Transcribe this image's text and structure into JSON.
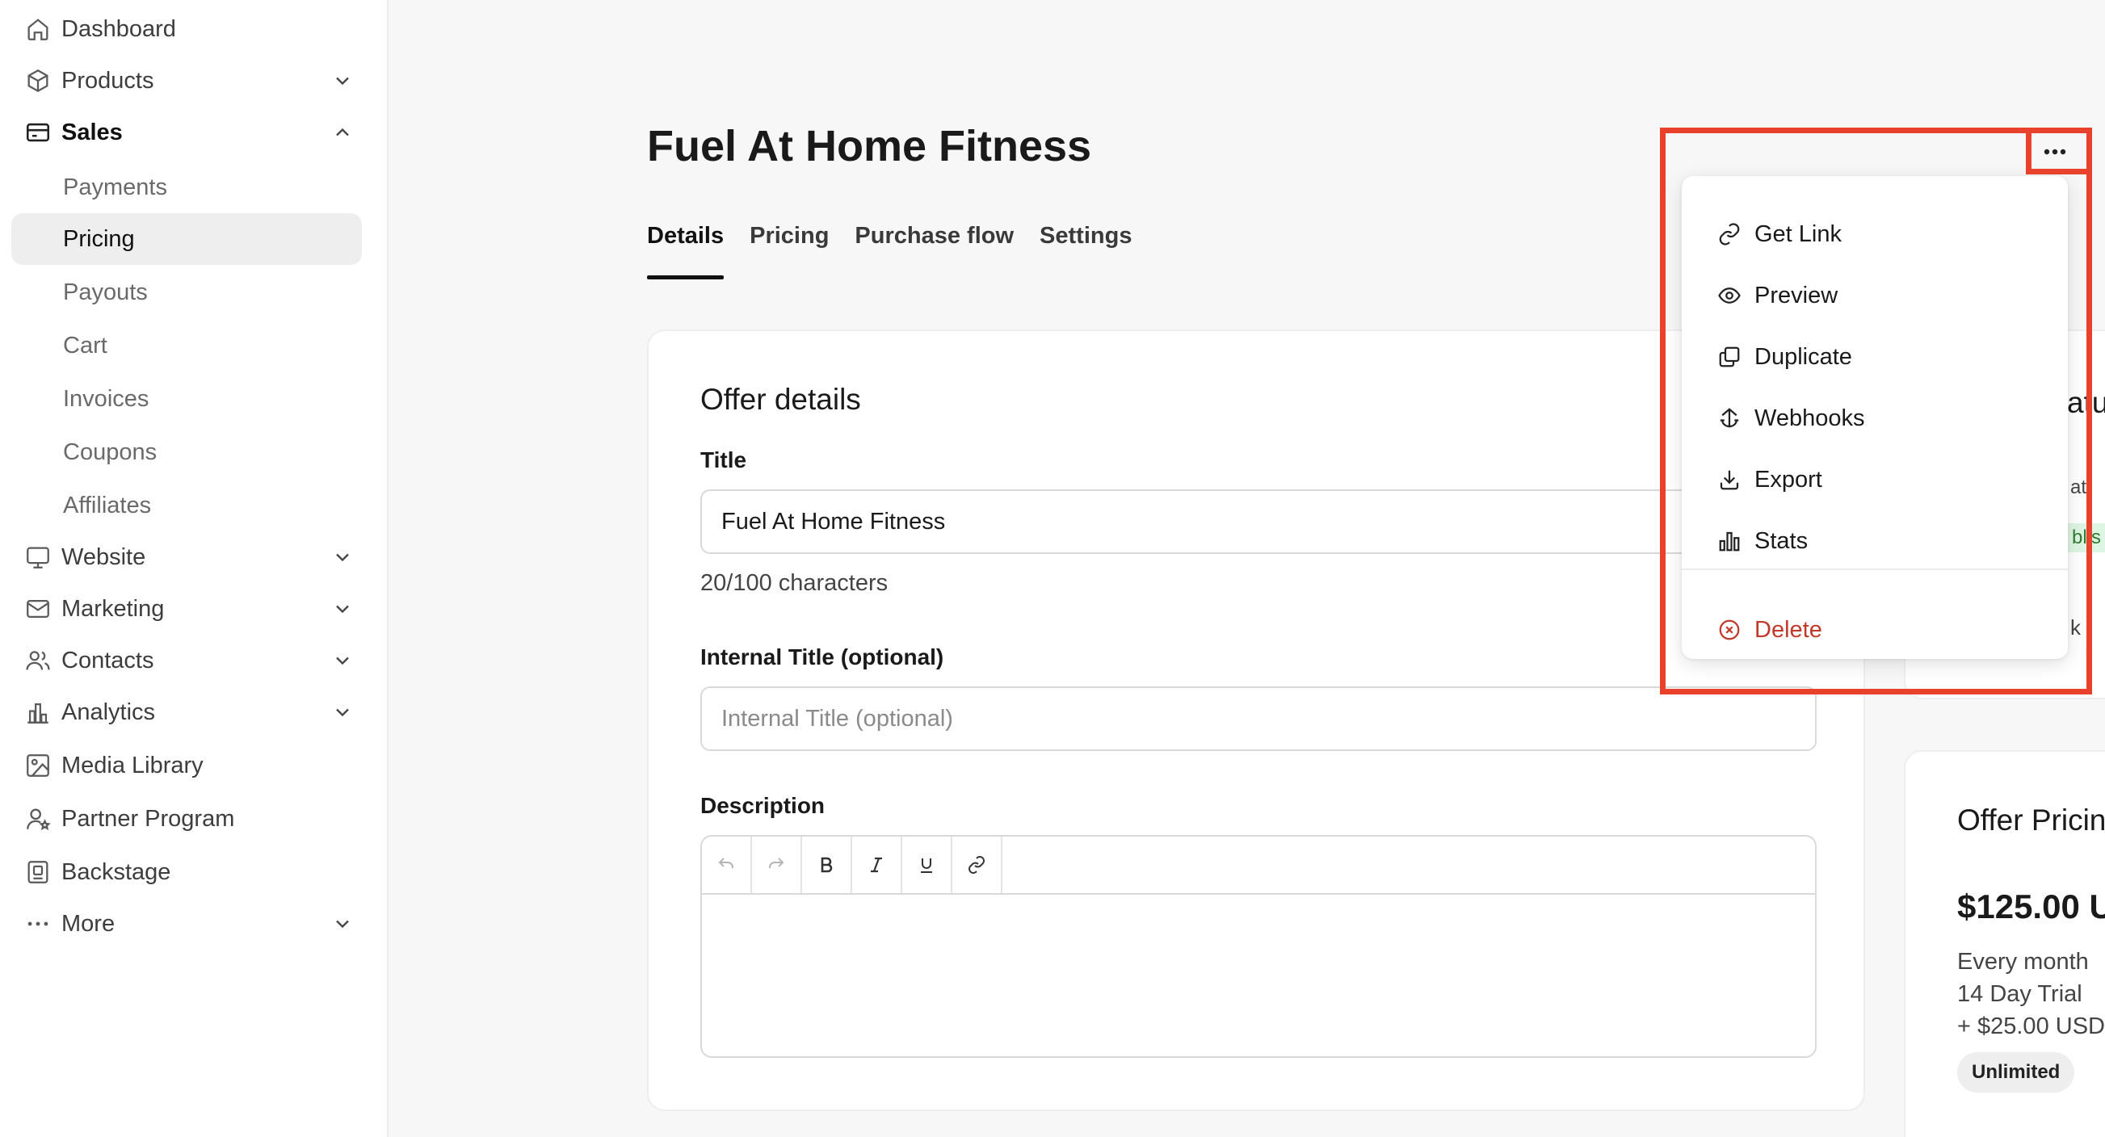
{
  "sidebar": {
    "items": [
      {
        "label": "Dashboard",
        "icon": "home-icon"
      },
      {
        "label": "Products",
        "icon": "box-icon"
      },
      {
        "label": "Sales",
        "icon": "card-icon"
      },
      {
        "label": "Website",
        "icon": "monitor-icon"
      },
      {
        "label": "Marketing",
        "icon": "mail-icon"
      },
      {
        "label": "Contacts",
        "icon": "users-icon"
      },
      {
        "label": "Analytics",
        "icon": "bar-chart-icon"
      },
      {
        "label": "Media Library",
        "icon": "image-icon"
      },
      {
        "label": "Partner Program",
        "icon": "partner-icon"
      },
      {
        "label": "Backstage",
        "icon": "backstage-icon"
      },
      {
        "label": "More",
        "icon": "ellipsis-icon"
      }
    ],
    "sales_sub": [
      "Payments",
      "Pricing",
      "Payouts",
      "Cart",
      "Invoices",
      "Coupons",
      "Affiliates"
    ],
    "active_sub": "Pricing"
  },
  "page": {
    "title": "Fuel At Home Fitness",
    "tabs": [
      "Details",
      "Pricing",
      "Purchase flow",
      "Settings"
    ],
    "active_tab": "Details"
  },
  "offer": {
    "section_title": "Offer details",
    "title_label": "Title",
    "title_value": "Fuel At Home Fitness",
    "title_count": "20/100 characters",
    "internal_label": "Internal Title (optional)",
    "internal_placeholder": "Internal Title (optional)",
    "description_label": "Description"
  },
  "right_top": {
    "heading_fragment": "atu",
    "line1_fragment": "at",
    "line2_fragment": "blis",
    "line3_fragment": "k"
  },
  "pricing_card": {
    "title": "Offer Pricin",
    "price": "$125.00 U",
    "lines": [
      "Every month",
      "14 Day Trial",
      "+ $25.00 USD"
    ],
    "badge": "Unlimited"
  },
  "menu": {
    "items": [
      {
        "label": "Get Link",
        "icon": "link-icon"
      },
      {
        "label": "Preview",
        "icon": "eye-icon"
      },
      {
        "label": "Duplicate",
        "icon": "duplicate-icon"
      },
      {
        "label": "Webhooks",
        "icon": "webhook-icon"
      },
      {
        "label": "Export",
        "icon": "download-icon"
      },
      {
        "label": "Stats",
        "icon": "stats-icon"
      }
    ],
    "delete_label": "Delete"
  },
  "colors": {
    "highlight": "#e8412c",
    "danger": "#c0392b",
    "success_bg": "#dff5e3"
  }
}
